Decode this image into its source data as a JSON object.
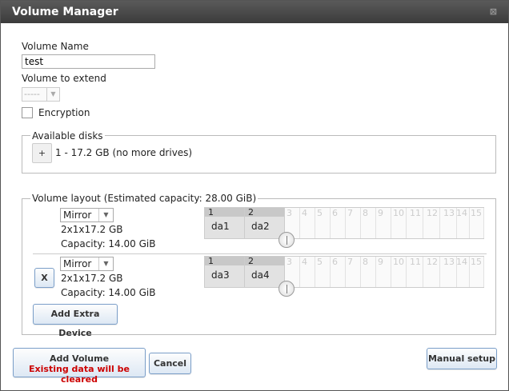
{
  "window": {
    "title": "Volume Manager",
    "close_glyph": "⊠"
  },
  "form": {
    "volume_name_label": "Volume Name",
    "volume_name_value": "test",
    "volume_extend_label": "Volume to extend",
    "volume_extend_value": "-----",
    "encryption_label": "Encryption",
    "encryption_checked": false
  },
  "available_disks": {
    "legend": "Available disks",
    "add_button": "+",
    "entry": "1 - 17.2 GB (no more drives)"
  },
  "volume_layout": {
    "legend": "Volume layout (Estimated capacity: 28.00 GiB)",
    "slot_numbers": [
      "1",
      "2",
      "3",
      "4",
      "5",
      "6",
      "7",
      "8",
      "9",
      "10",
      "11",
      "12",
      "13",
      "14",
      "15"
    ],
    "groups": [
      {
        "mode": "Mirror",
        "config": "2x1x17.2 GB",
        "capacity": "Capacity: 14.00 GiB",
        "disks": [
          "da1",
          "da2"
        ],
        "removable": false
      },
      {
        "mode": "Mirror",
        "config": "2x1x17.2 GB",
        "capacity": "Capacity: 14.00 GiB",
        "disks": [
          "da3",
          "da4"
        ],
        "removable": true,
        "remove_label": "X"
      }
    ],
    "add_extra_device": "Add Extra Device"
  },
  "footer": {
    "add_volume": "Add Volume",
    "add_volume_warning": "Existing data will be cleared",
    "cancel": "Cancel",
    "manual_setup": "Manual setup"
  },
  "colors": {
    "warning": "#cc0000",
    "titlebar": "#444444",
    "button_border": "#7a9ec8"
  }
}
